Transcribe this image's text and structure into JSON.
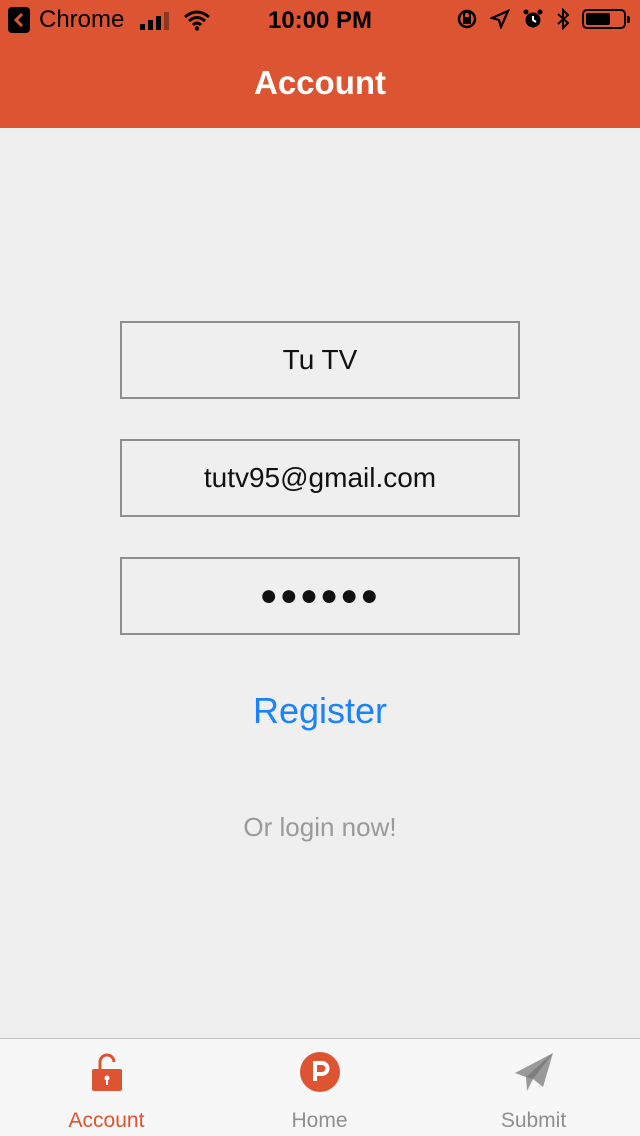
{
  "status_bar": {
    "back_app": "Chrome",
    "time": "10:00 PM"
  },
  "nav": {
    "title": "Account"
  },
  "form": {
    "name_value": "Tu TV",
    "email_value": "tutv95@gmail.com",
    "password_value": "●●●●●●"
  },
  "actions": {
    "register_label": "Register",
    "login_prompt": "Or login now!"
  },
  "tabs": [
    {
      "label": "Account",
      "icon": "lock-icon",
      "active": true
    },
    {
      "label": "Home",
      "icon": "product-hunt-icon",
      "active": false
    },
    {
      "label": "Submit",
      "icon": "paper-plane-icon",
      "active": false
    }
  ],
  "colors": {
    "brand": "#dc5431",
    "link": "#1a82fb",
    "background": "#efefef"
  }
}
